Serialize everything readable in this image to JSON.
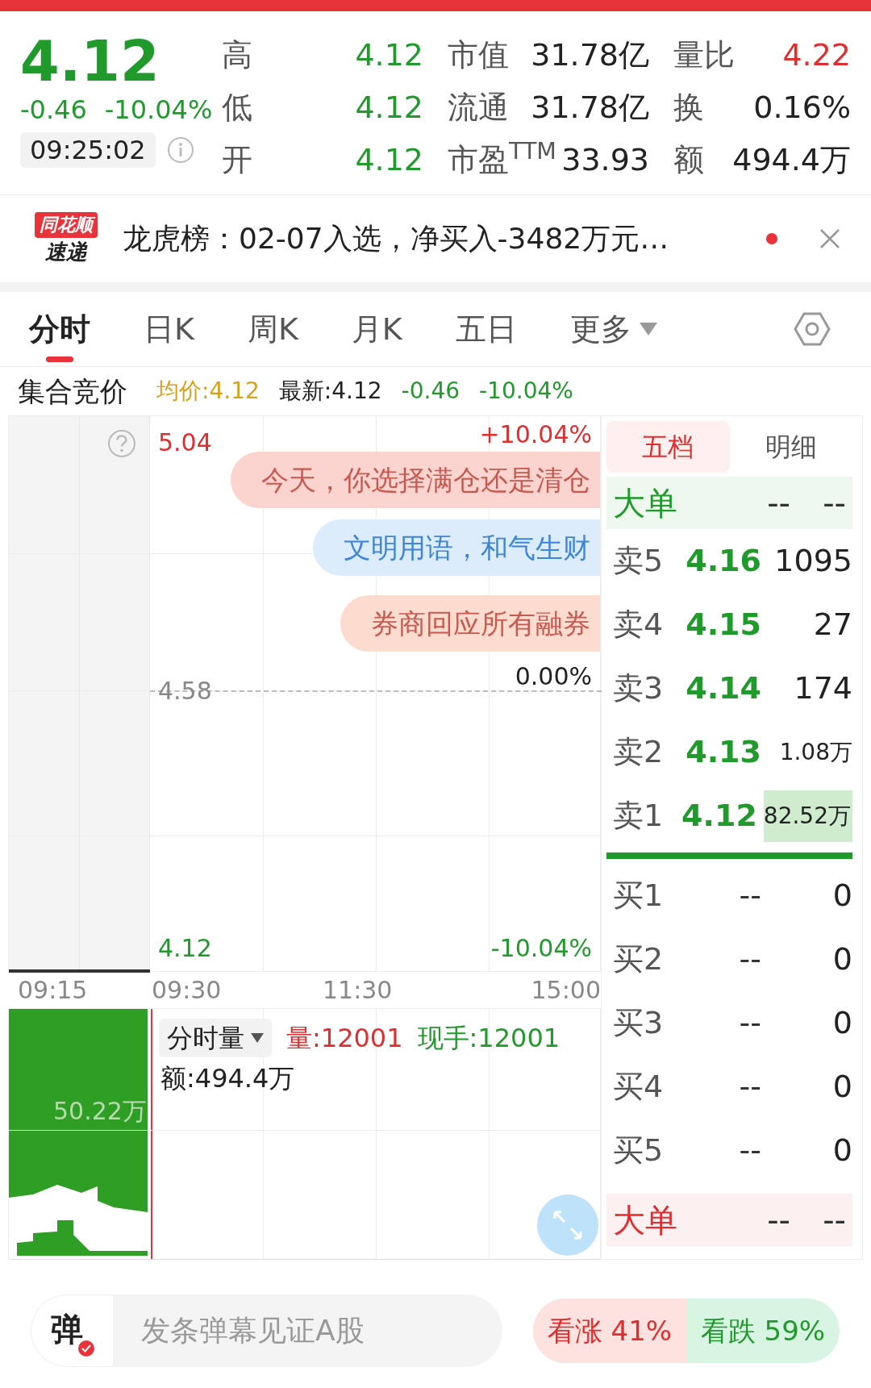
{
  "quote": {
    "price": "4.12",
    "change": "-0.46",
    "change_pct": "-10.04%",
    "time": "09:25:02"
  },
  "stats": [
    {
      "label": "高",
      "value": "4.12",
      "kind": "fall"
    },
    {
      "label": "市值",
      "value": "31.78亿",
      "kind": "neutral"
    },
    {
      "label": "量比",
      "value": "4.22",
      "kind": "rise"
    },
    {
      "label": "低",
      "value": "4.12",
      "kind": "fall"
    },
    {
      "label": "流通",
      "value": "31.78亿",
      "kind": "neutral"
    },
    {
      "label": "换",
      "value": "0.16%",
      "kind": "neutral"
    },
    {
      "label": "开",
      "value": "4.12",
      "kind": "fall"
    },
    {
      "label": "市盈$^{TTM}$",
      "value": "33.93",
      "kind": "neutral"
    },
    {
      "label": "额",
      "value": "494.4万",
      "kind": "neutral"
    }
  ],
  "news": {
    "logo_top": "同花顺",
    "logo_bottom": "速递",
    "text": "龙虎榜：02-07入选，净买入-3482万元…",
    "unread": true
  },
  "tabs": [
    {
      "label": "分时",
      "selected": true,
      "kind": "tab"
    },
    {
      "label": "日K",
      "selected": false,
      "kind": "tab"
    },
    {
      "label": "周K",
      "selected": false,
      "kind": "tab"
    },
    {
      "label": "月K",
      "selected": false,
      "kind": "tab"
    },
    {
      "label": "五日",
      "selected": false,
      "kind": "tab"
    },
    {
      "label": "更多",
      "selected": false,
      "kind": "menu"
    }
  ],
  "info": {
    "label": "集合竞价",
    "items": [
      {
        "text": "均价:4.12",
        "kind": "avg"
      },
      {
        "text": "最新:4.12",
        "kind": "neutral"
      },
      {
        "text": "-0.46",
        "kind": "fall"
      },
      {
        "text": "-10.04%",
        "kind": "fall"
      }
    ]
  },
  "chart": {
    "price_high": "5.04",
    "price_mid": "4.58",
    "price_low": "4.12",
    "pct_high": "+10.04%",
    "pct_mid": "0.00%",
    "pct_low": "-10.04%",
    "times": [
      "09:15",
      "09:30",
      "11:30",
      "15:00"
    ]
  },
  "danmaku": [
    {
      "text": "今天，你选择满仓还是清仓",
      "color": "#fbd3cf"
    },
    {
      "text": "文明用语，和气生财",
      "color": "#dcecfb"
    },
    {
      "text": "券商回应所有融券",
      "color": "#fcdccf"
    }
  ],
  "volume": {
    "selector": "分时量",
    "volume": "量:12001",
    "current": "现手:12001",
    "amount": "额:494.4万",
    "axis_label": "50.22万"
  },
  "order_book": {
    "tabs": [
      {
        "label": "五档",
        "selected": true
      },
      {
        "label": "明细",
        "selected": false
      }
    ],
    "rows": [
      {
        "kind": "big_sell",
        "label": "大单",
        "price": "--",
        "volume": "--"
      },
      {
        "kind": "level",
        "label": "卖5",
        "price": "4.16",
        "volume": "1095",
        "highlighted": false
      },
      {
        "kind": "level",
        "label": "卖4",
        "price": "4.15",
        "volume": "27",
        "highlighted": false
      },
      {
        "kind": "level",
        "label": "卖3",
        "price": "4.14",
        "volume": "174",
        "highlighted": false
      },
      {
        "kind": "level",
        "label": "卖2",
        "price": "4.13",
        "volume": "1.08万",
        "highlighted": false
      },
      {
        "kind": "level",
        "label": "卖1",
        "price": "4.12",
        "volume": "82.52万",
        "highlighted": true
      },
      {
        "kind": "balance",
        "level": 1
      },
      {
        "kind": "level",
        "label": "买1",
        "price": "--",
        "volume": "0",
        "highlighted": false
      },
      {
        "kind": "level",
        "label": "买2",
        "price": "--",
        "volume": "0",
        "highlighted": false
      },
      {
        "kind": "level",
        "label": "买3",
        "price": "--",
        "volume": "0",
        "highlighted": false
      },
      {
        "kind": "level",
        "label": "买4",
        "price": "--",
        "volume": "0",
        "highlighted": false
      },
      {
        "kind": "level",
        "label": "买5",
        "price": "--",
        "volume": "0",
        "highlighted": false
      },
      {
        "kind": "big_buy",
        "label": "大单",
        "price": "--",
        "volume": "--"
      }
    ]
  },
  "bottom": {
    "button": "弹",
    "placeholder": "发条弹幕见证A股",
    "vote": {
      "rise": "看涨 41%",
      "fall": "看跌 59%",
      "level": 0.5
    }
  }
}
